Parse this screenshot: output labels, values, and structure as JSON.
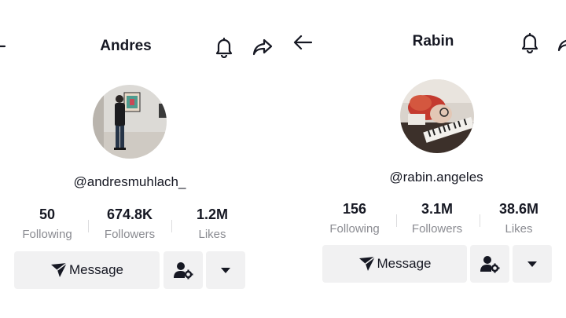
{
  "profiles": [
    {
      "name": "Andres",
      "handle": "@andresmuhlach_",
      "stats": [
        {
          "value": "50",
          "label": "Following"
        },
        {
          "value": "674.8K",
          "label": "Followers"
        },
        {
          "value": "1.2M",
          "label": "Likes"
        }
      ],
      "message_label": "Message",
      "icons": [
        "back-arrow-icon",
        "bell-icon",
        "share-icon",
        "add-friend-icon",
        "chevron-down-icon",
        "send-icon"
      ]
    },
    {
      "name": "Rabin",
      "handle": "@rabin.angeles",
      "stats": [
        {
          "value": "156",
          "label": "Following"
        },
        {
          "value": "3.1M",
          "label": "Followers"
        },
        {
          "value": "38.6M",
          "label": "Likes"
        }
      ],
      "message_label": "Message",
      "icons": [
        "back-arrow-icon",
        "bell-icon",
        "share-icon",
        "add-friend-icon",
        "chevron-down-icon",
        "send-icon"
      ]
    }
  ],
  "colors": {
    "text": "#161823",
    "secondary_text": "#8a8b91",
    "button_bg": "#f1f1f2"
  }
}
